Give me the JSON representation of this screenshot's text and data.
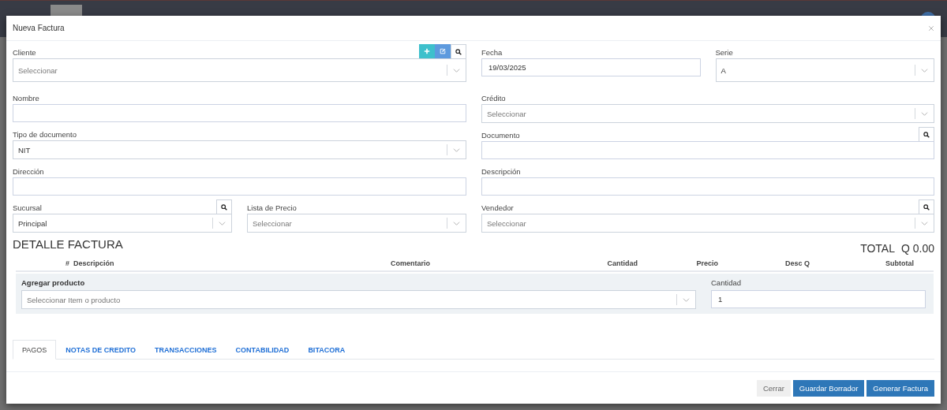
{
  "window": {
    "title": "Nueva Factura"
  },
  "form": {
    "left": [
      {
        "kind": "select",
        "label": "Cliente",
        "placeholder": "Seleccionar",
        "actions": [
          {
            "kind": "add"
          },
          {
            "kind": "edit"
          },
          {
            "kind": "search"
          }
        ]
      },
      {
        "kind": "input",
        "label": "Nombre"
      },
      {
        "kind": "select",
        "label": "Tipo de documento",
        "value": "NIT"
      },
      {
        "kind": "input",
        "label": "Dirección"
      },
      {
        "kind": "pair",
        "fields": [
          {
            "kind": "select",
            "label": "Sucursal",
            "value": "Principal",
            "actions": [
              {
                "kind": "search"
              }
            ]
          },
          {
            "kind": "select",
            "label": "Lista de Precio",
            "placeholder": "Seleccionar"
          }
        ]
      }
    ],
    "right": [
      {
        "kind": "pair",
        "fields": [
          {
            "kind": "input",
            "label": "Fecha",
            "value": "19/03/2025"
          },
          {
            "kind": "select",
            "label": "Serie",
            "value": "A"
          }
        ]
      },
      {
        "kind": "select",
        "label": "Crédito",
        "placeholder": "Seleccionar"
      },
      {
        "kind": "input",
        "label": "Documento",
        "actions": [
          {
            "kind": "search"
          }
        ]
      },
      {
        "kind": "input",
        "label": "Descripción"
      },
      {
        "kind": "select",
        "label": "Vendedor",
        "placeholder": "Seleccionar",
        "actions": [
          {
            "kind": "search"
          }
        ]
      }
    ]
  },
  "detail": {
    "title": "DETALLE FACTURA",
    "total_label": "TOTAL",
    "total": "Q 0.00",
    "columns": [
      "#",
      "Descripción",
      "Comentario",
      "Cantidad",
      "Precio",
      "Desc Q",
      "Subtotal"
    ],
    "add_product": {
      "label": "Agregar producto",
      "placeholder": "Seleccionar Item o producto",
      "quantity_label": "Cantidad",
      "quantity": "1"
    }
  },
  "tabs": [
    {
      "label": "PAGOS",
      "selected": true
    },
    {
      "label": "NOTAS DE CREDITO",
      "selected": false
    },
    {
      "label": "TRANSACCIONES",
      "selected": false
    },
    {
      "label": "CONTABILIDAD",
      "selected": false
    },
    {
      "label": "BITACORA",
      "selected": false
    }
  ],
  "buttons": [
    {
      "label": "Cerrar",
      "kind": "default"
    },
    {
      "label": "Guardar Borrador",
      "kind": "primary"
    },
    {
      "label": "Generar Factura",
      "kind": "primary"
    }
  ]
}
